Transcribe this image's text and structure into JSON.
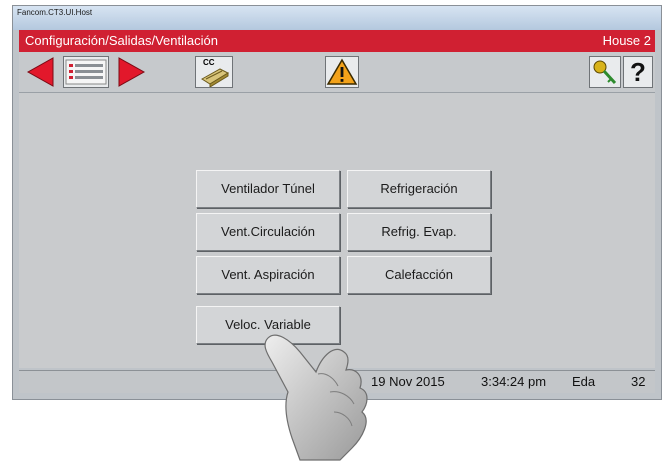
{
  "window": {
    "title": "Fancom.CT3.UI.Host"
  },
  "header": {
    "path": "Configuración/Salidas/Ventilación",
    "house": "House 2"
  },
  "toolbar": {
    "back_icon": "arrow-left-icon",
    "list_icon": "list-icon",
    "forward_icon": "arrow-right-icon",
    "cc_label": "CC",
    "alarm_icon": "warning-icon",
    "key_icon": "key-icon",
    "help_label": "?"
  },
  "menu": {
    "buttons": [
      "Ventilador Túnel",
      "Refrigeración",
      "Vent.Circulación",
      "Refrig. Evap.",
      "Vent. Aspiración",
      "Calefacción",
      "Veloc. Variable"
    ]
  },
  "status": {
    "date": "19 Nov 2015",
    "time": "3:34:24 pm",
    "user": "Eda",
    "number": "32"
  },
  "colors": {
    "header_red": "#d02032",
    "arrow_red": "#e2182b",
    "background_gray": "#c9cbcd"
  }
}
